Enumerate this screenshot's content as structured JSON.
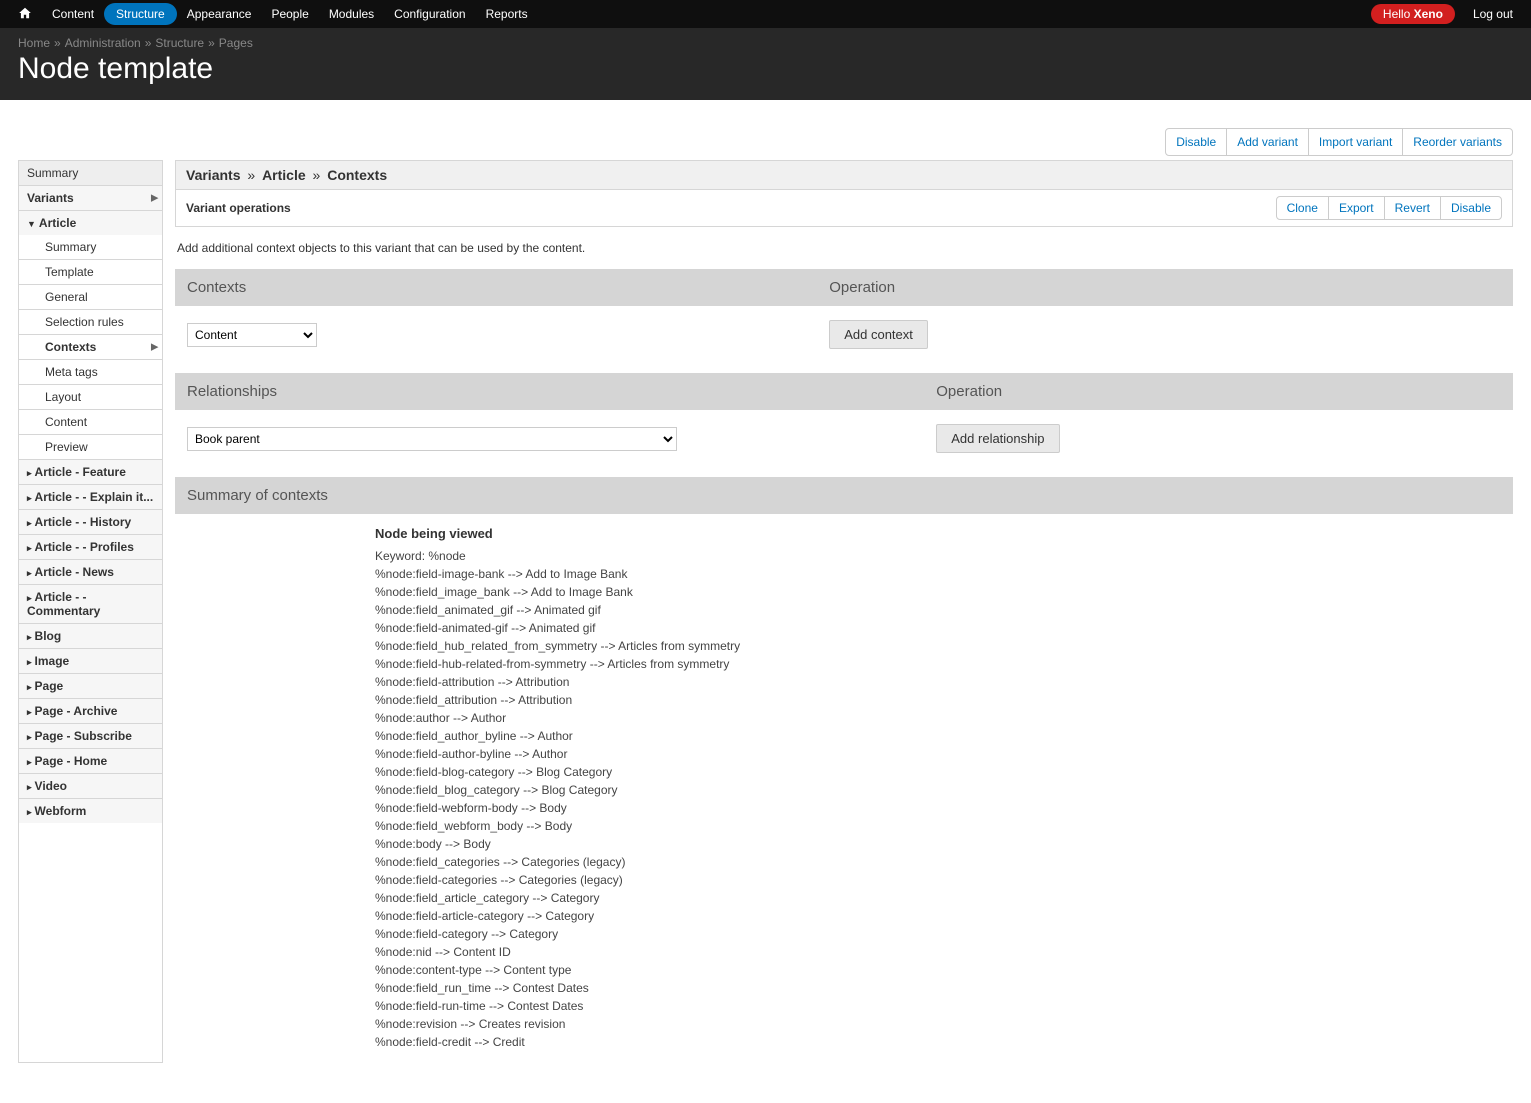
{
  "toolbar": {
    "items": [
      "Content",
      "Structure",
      "Appearance",
      "People",
      "Modules",
      "Configuration",
      "Reports"
    ],
    "active_index": 1,
    "hello_prefix": "Hello ",
    "hello_name": "Xeno",
    "logout": "Log out"
  },
  "breadcrumb": {
    "items": [
      "Home",
      "Administration",
      "Structure",
      "Pages"
    ]
  },
  "page_title": "Node template",
  "page_actions": [
    "Disable",
    "Add variant",
    "Import variant",
    "Reorder variants"
  ],
  "sidebar": {
    "summary": "Summary",
    "variants": "Variants",
    "article": "Article",
    "article_children": [
      "Summary",
      "Template",
      "General",
      "Selection rules",
      "Contexts",
      "Meta tags",
      "Layout",
      "Content",
      "Preview"
    ],
    "article_active_child_index": 4,
    "other_variants": [
      "Article - Feature",
      "Article - - Explain it...",
      "Article - - History",
      "Article - - Profiles",
      "Article - News",
      "Article - - Commentary",
      "Blog",
      "Image",
      "Page",
      "Page - Archive",
      "Page - Subscribe",
      "Page - Home",
      "Video",
      "Webform"
    ]
  },
  "main": {
    "crumb": [
      "Variants",
      "Article",
      "Contexts"
    ],
    "variant_ops_title": "Variant operations",
    "variant_ops": [
      "Clone",
      "Export",
      "Revert",
      "Disable"
    ],
    "help_text": "Add additional context objects to this variant that can be used by the content.",
    "contexts": {
      "col1": "Contexts",
      "col2": "Operation",
      "select_value": "Content",
      "button": "Add context"
    },
    "relationships": {
      "col1": "Relationships",
      "col2": "Operation",
      "select_value": "Book parent",
      "button": "Add relationship"
    },
    "summary_header": "Summary of contexts",
    "summary_title": "Node being viewed",
    "summary_lines": [
      "Keyword: %node",
      "%node:field-image-bank --> Add to Image Bank",
      "%node:field_image_bank --> Add to Image Bank",
      "%node:field_animated_gif --> Animated gif",
      "%node:field-animated-gif --> Animated gif",
      "%node:field_hub_related_from_symmetry --> Articles from symmetry",
      "%node:field-hub-related-from-symmetry --> Articles from symmetry",
      "%node:field-attribution --> Attribution",
      "%node:field_attribution --> Attribution",
      "%node:author --> Author",
      "%node:field_author_byline --> Author",
      "%node:field-author-byline --> Author",
      "%node:field-blog-category --> Blog Category",
      "%node:field_blog_category --> Blog Category",
      "%node:field-webform-body --> Body",
      "%node:field_webform_body --> Body",
      "%node:body --> Body",
      "%node:field_categories --> Categories (legacy)",
      "%node:field-categories --> Categories (legacy)",
      "%node:field_article_category --> Category",
      "%node:field-article-category --> Category",
      "%node:field-category --> Category",
      "%node:nid --> Content ID",
      "%node:content-type --> Content type",
      "%node:field_run_time --> Contest Dates",
      "%node:field-run-time --> Contest Dates",
      "%node:revision --> Creates revision",
      "%node:field-credit --> Credit"
    ]
  }
}
